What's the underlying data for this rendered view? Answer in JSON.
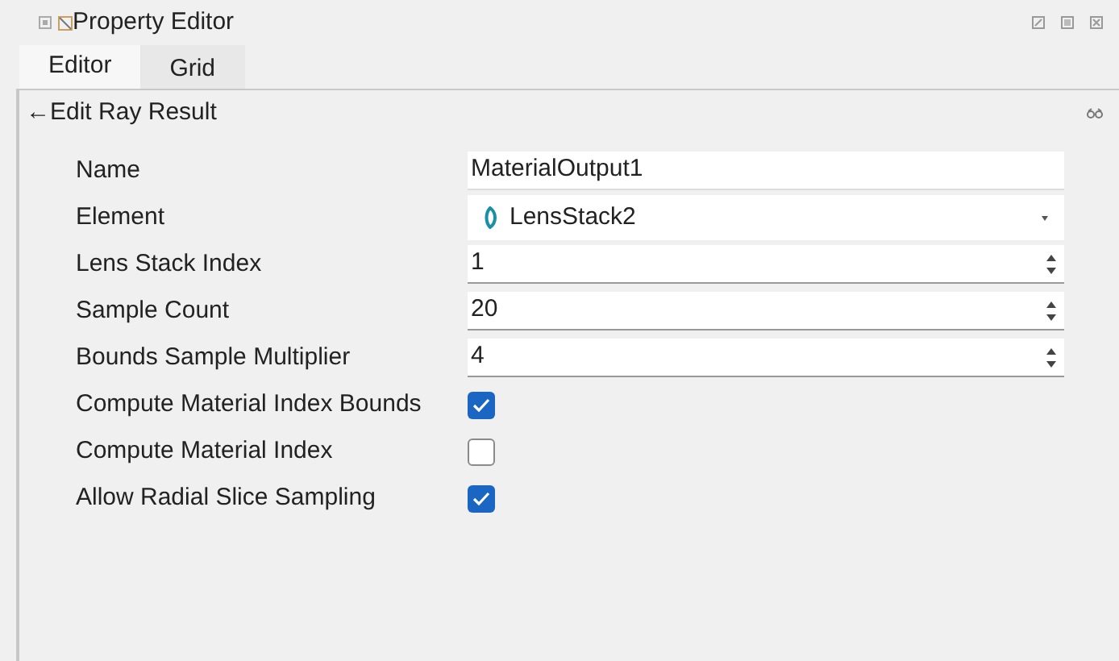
{
  "window": {
    "title": "Property Editor"
  },
  "tabs": [
    {
      "label": "Editor",
      "selected": true
    },
    {
      "label": "Grid",
      "selected": false
    }
  ],
  "header": {
    "back": "←",
    "title": "Edit Ray Result"
  },
  "properties": [
    {
      "label": "Name",
      "kind": "text",
      "value": "MaterialOutput1"
    },
    {
      "label": "Element",
      "kind": "dropdown",
      "value": "LensStack2"
    },
    {
      "label": "Lens Stack Index",
      "kind": "spin",
      "value": "1"
    },
    {
      "label": "Sample Count",
      "kind": "spin",
      "value": "20"
    },
    {
      "label": "Bounds Sample Multiplier",
      "kind": "spin",
      "value": "4"
    },
    {
      "label": "Compute Material Index Bounds",
      "kind": "checkbox",
      "checked": true
    },
    {
      "label": "Compute Material Index",
      "kind": "checkbox",
      "checked": false
    },
    {
      "label": "Allow Radial Slice Sampling",
      "kind": "checkbox",
      "checked": true
    }
  ]
}
